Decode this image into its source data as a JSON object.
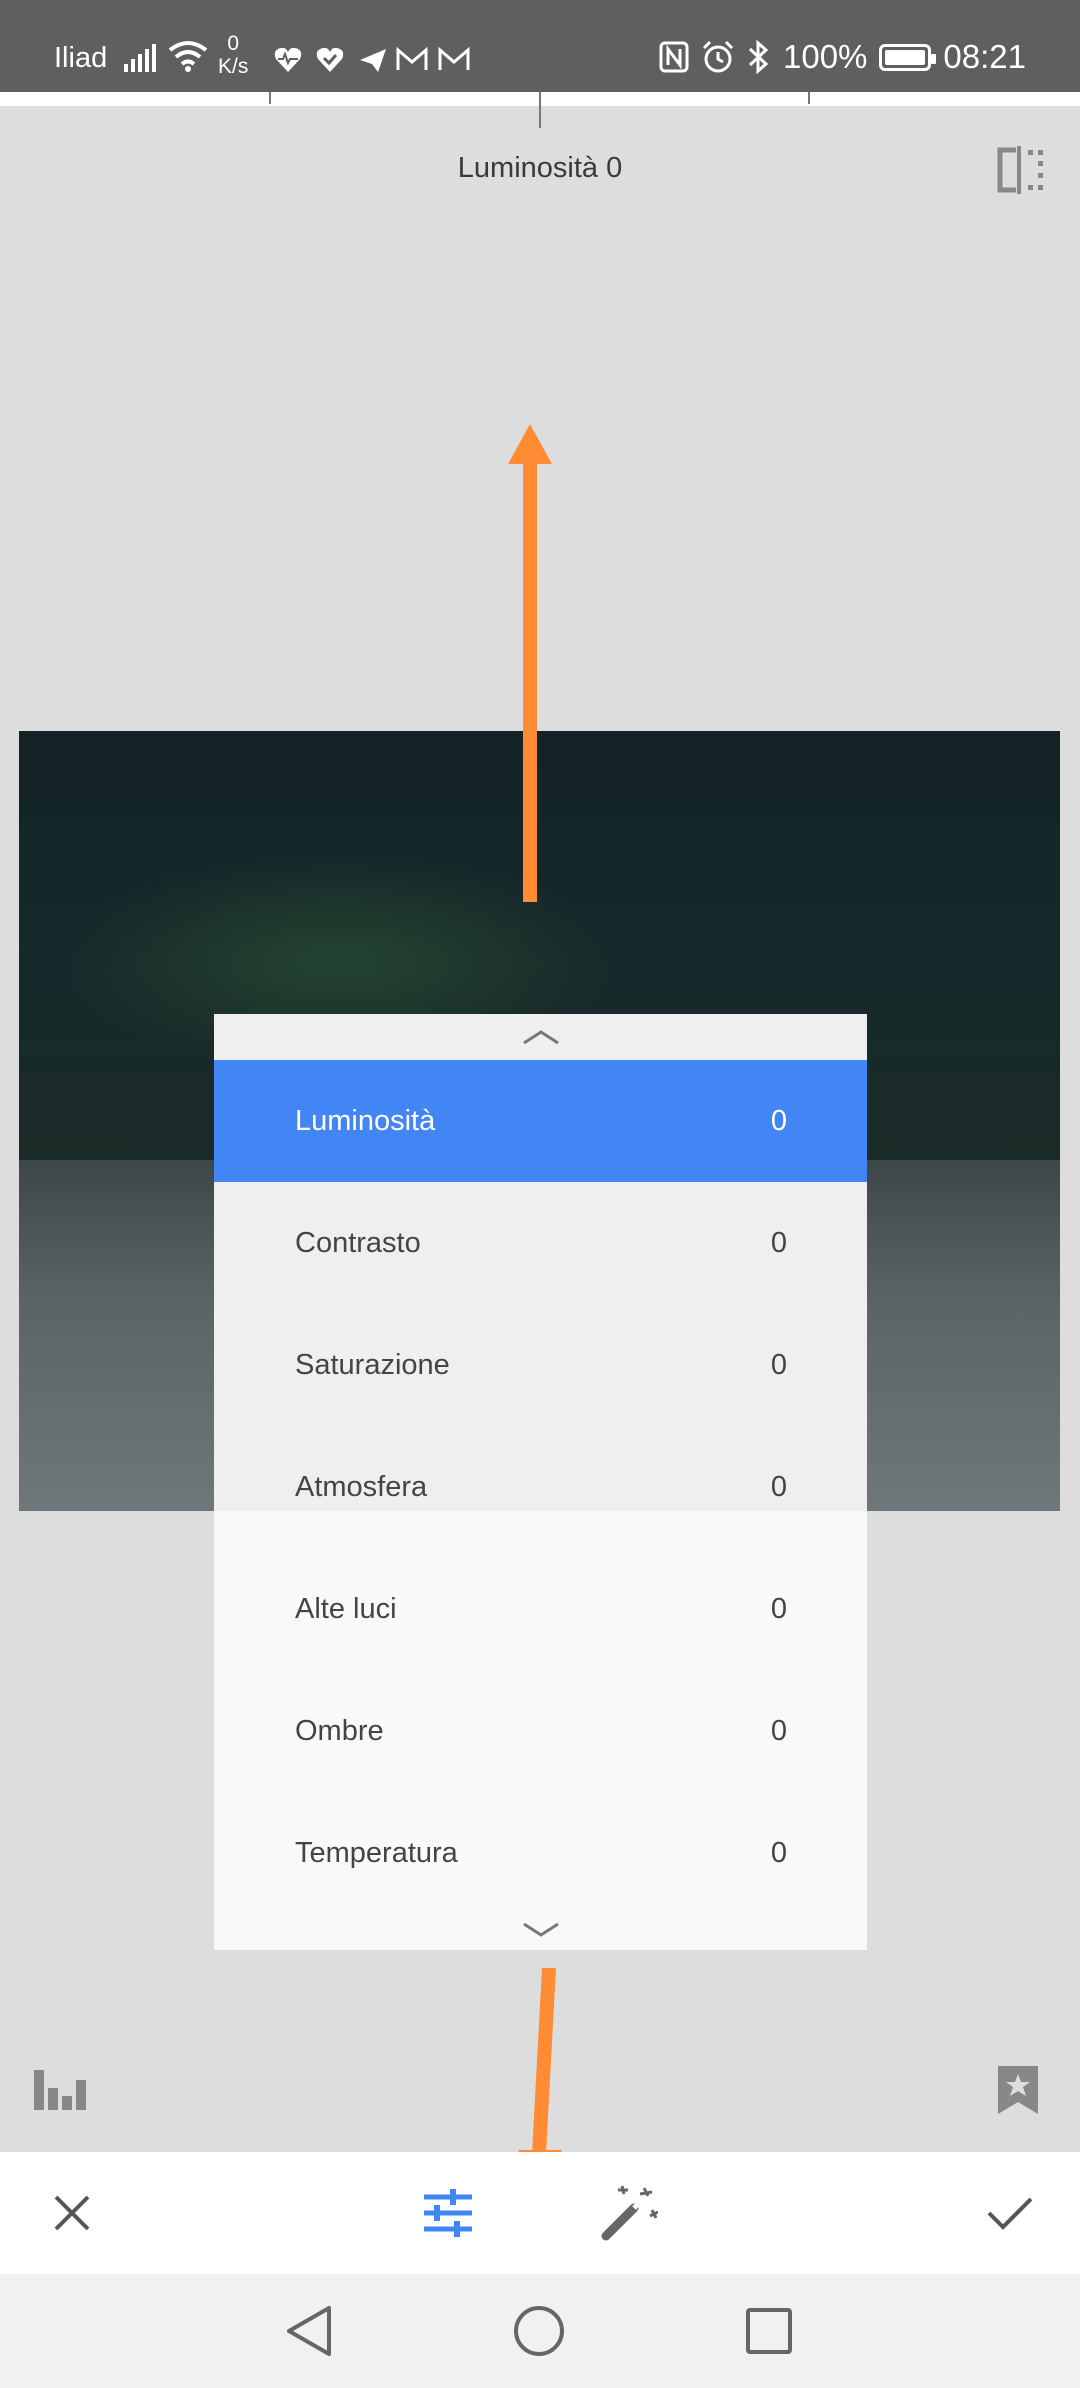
{
  "status_bar": {
    "carrier": "Iliad",
    "net_speed_value": "0",
    "net_speed_unit": "K/s",
    "battery": "100%",
    "time": "08:21"
  },
  "editor": {
    "current_adjustment": "Luminosità 0"
  },
  "adjustments": [
    {
      "label": "Luminosità",
      "value": "0"
    },
    {
      "label": "Contrasto",
      "value": "0"
    },
    {
      "label": "Saturazione",
      "value": "0"
    },
    {
      "label": "Atmosfera",
      "value": "0"
    },
    {
      "label": "Alte luci",
      "value": "0"
    },
    {
      "label": "Ombre",
      "value": "0"
    },
    {
      "label": "Temperatura",
      "value": "0"
    }
  ],
  "colors": {
    "accent": "#4285f4",
    "annotation_arrow": "#ff8c35"
  },
  "icons": {
    "compare": "compare-icon",
    "histogram": "histogram-icon",
    "bookmark": "bookmark-star-icon",
    "close": "close-icon",
    "adjust": "sliders-icon",
    "auto": "magic-wand-icon",
    "apply": "checkmark-icon",
    "back": "back-triangle-icon",
    "home": "home-circle-icon",
    "recents": "recents-square-icon"
  }
}
